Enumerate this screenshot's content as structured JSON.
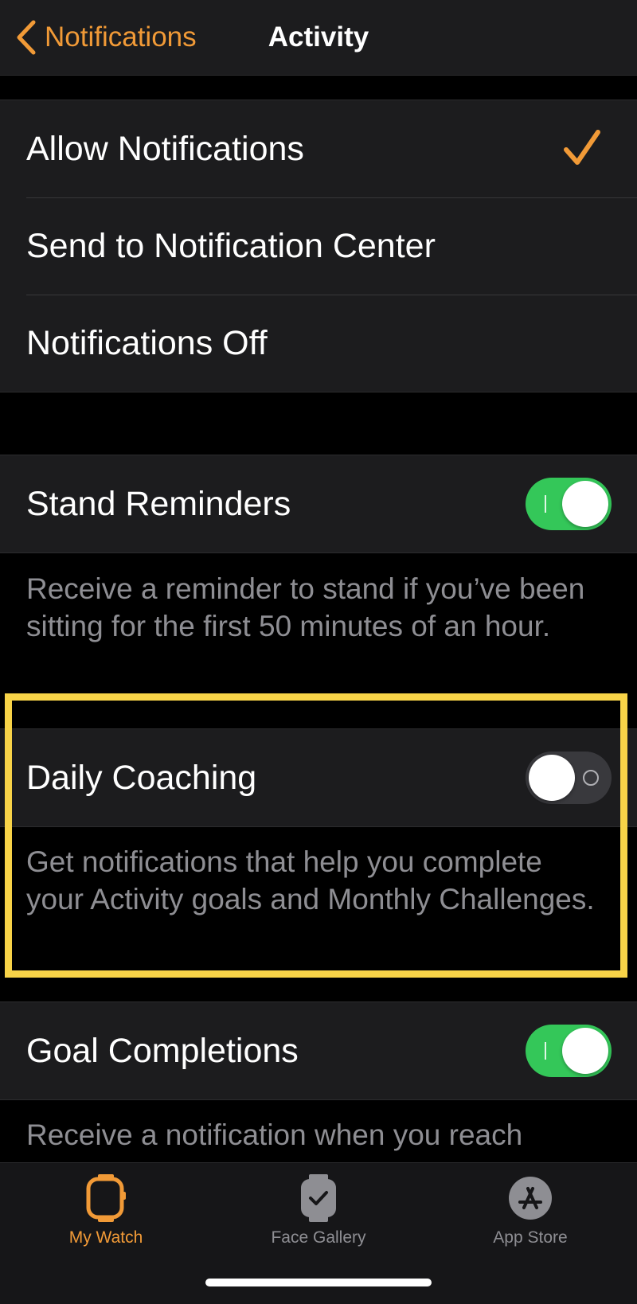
{
  "nav": {
    "back_label": "Notifications",
    "title": "Activity"
  },
  "notification_options": [
    {
      "label": "Allow Notifications",
      "selected": true
    },
    {
      "label": "Send to Notification Center",
      "selected": false
    },
    {
      "label": "Notifications Off",
      "selected": false
    }
  ],
  "stand_reminders": {
    "label": "Stand Reminders",
    "enabled": true,
    "description": "Receive a reminder to stand if you’ve been sitting for the first 50 minutes of an hour."
  },
  "daily_coaching": {
    "label": "Daily Coaching",
    "enabled": false,
    "description": "Get notifications that help you complete your Activity goals and Monthly Challenges."
  },
  "goal_completions": {
    "label": "Goal Completions",
    "enabled": true,
    "description_partial": "Receive a notification when you reach"
  },
  "tabs": [
    {
      "label": "My Watch",
      "icon": "watch-icon",
      "active": true
    },
    {
      "label": "Face Gallery",
      "icon": "face-gallery-icon",
      "active": false
    },
    {
      "label": "App Store",
      "icon": "app-store-icon",
      "active": false
    }
  ],
  "colors": {
    "accent": "#f19a37",
    "toggle_on": "#34c759",
    "highlight": "#f8d348",
    "inactive_tab": "#8e8e93"
  }
}
